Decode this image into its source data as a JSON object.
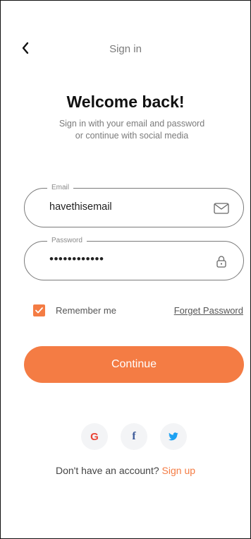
{
  "header": {
    "title": "Sign in"
  },
  "welcome": {
    "heading": "Welcome back!",
    "subtitle_line1": "Sign in with your email and password",
    "subtitle_line2": "or continue with social media"
  },
  "email": {
    "label": "Email",
    "value": "havethisemail"
  },
  "password": {
    "label": "Password",
    "value": "••••••••••••"
  },
  "remember": {
    "label": "Remember me",
    "checked": true
  },
  "forget": {
    "label": "Forget Password"
  },
  "continue": {
    "label": "Continue"
  },
  "social": [
    {
      "name": "google-icon",
      "glyph": "G"
    },
    {
      "name": "facebook-icon",
      "glyph": "f"
    },
    {
      "name": "twitter-icon"
    }
  ],
  "signup": {
    "prompt": "Don't have an account?",
    "link": "Sign up"
  },
  "colors": {
    "accent": "#f47c44",
    "muted": "#7b7b7b"
  }
}
